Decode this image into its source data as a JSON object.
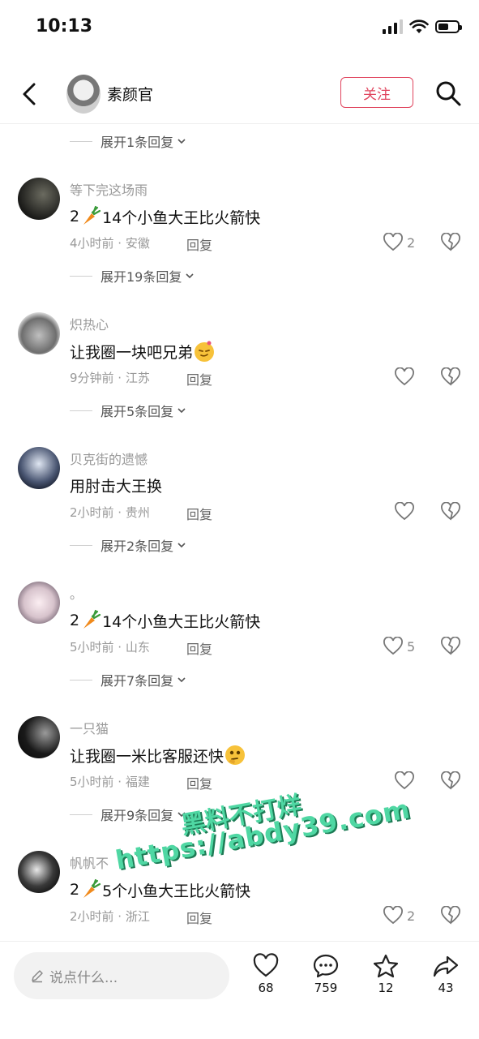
{
  "status_bar": {
    "time": "10:13"
  },
  "header": {
    "author_name": "素颜官",
    "follow_label": "关注"
  },
  "top_expand": {
    "label": "展开1条回复"
  },
  "comments": [
    {
      "user": "等下完这场雨",
      "text_before": "2",
      "text_after": "14个小鱼大王比火箭快",
      "meta": "4小时前 · 安徽",
      "reply": "回复",
      "likes": "2",
      "expand": "展开19条回复"
    },
    {
      "user": "炽热心",
      "text_before": "让我圈一块吧兄弟",
      "text_after": "",
      "meta": "9分钟前 · 江苏",
      "reply": "回复",
      "likes": "",
      "expand": "展开5条回复"
    },
    {
      "user": "贝克街的遗憾",
      "text_before": "用肘击大王换",
      "text_after": "",
      "meta": "2小时前 · 贵州",
      "reply": "回复",
      "likes": "",
      "expand": "展开2条回复"
    },
    {
      "user": "。",
      "text_before": "2",
      "text_after": "14个小鱼大王比火箭快",
      "meta": "5小时前 · 山东",
      "reply": "回复",
      "likes": "5",
      "expand": "展开7条回复"
    },
    {
      "user": "一只猫",
      "text_before": "让我圈一米比客服还快",
      "text_after": "",
      "meta": "5小时前 · 福建",
      "reply": "回复",
      "likes": "",
      "expand": "展开9条回复"
    },
    {
      "user": "帆帆不",
      "text_before": "2",
      "text_after": "5个小鱼大王比火箭快",
      "meta": "2小时前 · 浙江",
      "reply": "回复",
      "likes": "2",
      "expand": ""
    }
  ],
  "bottom_bar": {
    "input_placeholder": "说点什么...",
    "like_count": "68",
    "comment_count": "759",
    "star_count": "12",
    "share_count": "43"
  },
  "watermark": {
    "line1": "黑料不打烊",
    "line2": "https://abdy39.com"
  },
  "colors": {
    "accent": "#e0455e",
    "watermark": "#4fd7a3"
  }
}
